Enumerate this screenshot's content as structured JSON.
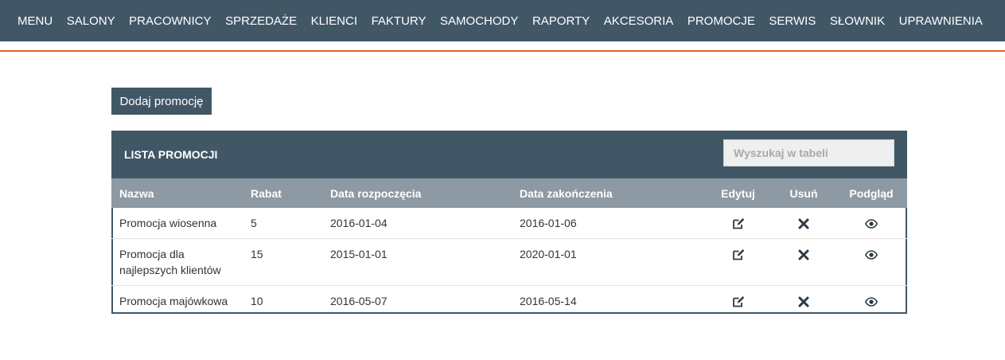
{
  "nav": {
    "items": [
      {
        "label": "MENU",
        "name": "nav-menu"
      },
      {
        "label": "SALONY",
        "name": "nav-salony"
      },
      {
        "label": "PRACOWNICY",
        "name": "nav-pracownicy"
      },
      {
        "label": "SPRZEDAŻE",
        "name": "nav-sprzedaze"
      },
      {
        "label": "KLIENCI",
        "name": "nav-klienci"
      },
      {
        "label": "FAKTURY",
        "name": "nav-faktury"
      },
      {
        "label": "SAMOCHODY",
        "name": "nav-samochody"
      },
      {
        "label": "RAPORTY",
        "name": "nav-raporty"
      },
      {
        "label": "AKCESORIA",
        "name": "nav-akcesoria"
      },
      {
        "label": "PROMOCJE",
        "name": "nav-promocje"
      },
      {
        "label": "SERWIS",
        "name": "nav-serwis"
      },
      {
        "label": "SŁOWNIK",
        "name": "nav-slownik"
      },
      {
        "label": "UPRAWNIENIA",
        "name": "nav-uprawnienia"
      }
    ]
  },
  "colors": {
    "primary": "#415766",
    "accent": "#e0632f",
    "table_header": "#8d9aa3"
  },
  "add_button": {
    "label": "Dodaj promocję"
  },
  "panel": {
    "title": "LISTA PROMOCJI",
    "search_placeholder": "Wyszukaj w tabeli"
  },
  "table": {
    "headers": [
      "Nazwa",
      "Rabat",
      "Data rozpoczęcia",
      "Data zakończenia",
      "Edytuj",
      "Usuń",
      "Podgląd"
    ],
    "rows": [
      {
        "nazwa": "Promocja wiosenna",
        "rabat": "5",
        "start": "2016-01-04",
        "end": "2016-01-06"
      },
      {
        "nazwa": "Promocja dla najlepszych klientów",
        "rabat": "15",
        "start": "2015-01-01",
        "end": "2020-01-01"
      },
      {
        "nazwa": "Promocja majówkowa",
        "rabat": "10",
        "start": "2016-05-07",
        "end": "2016-05-14"
      }
    ],
    "row_icons": {
      "edit": "edit-icon",
      "delete": "close-icon",
      "view": "eye-icon"
    }
  }
}
